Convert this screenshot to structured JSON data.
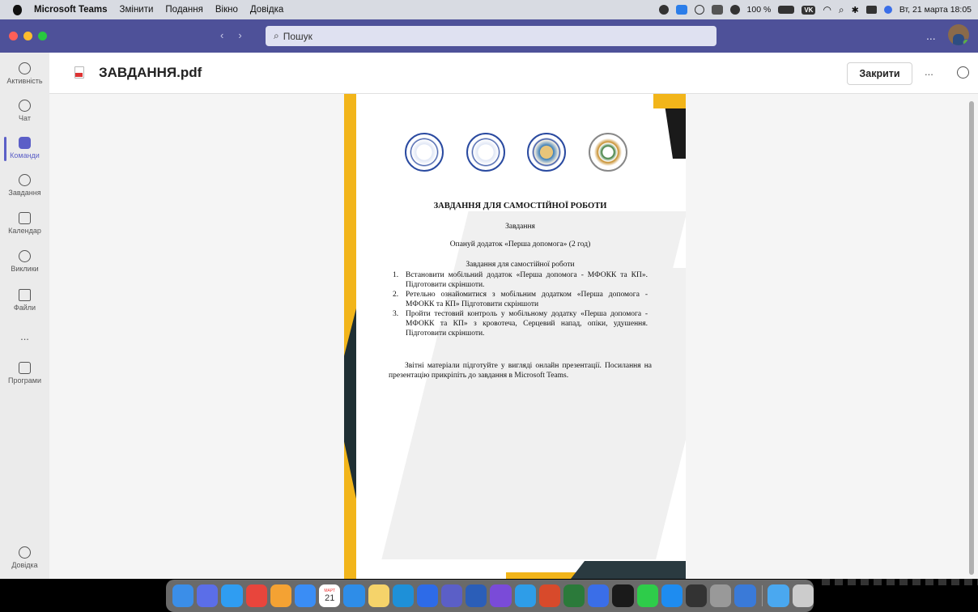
{
  "menubar": {
    "app_name": "Microsoft Teams",
    "items": [
      "Змінити",
      "Подання",
      "Вікно",
      "Довідка"
    ],
    "battery": "100 %",
    "keyboard": "VK",
    "datetime": "Вт, 21 марта 18:05"
  },
  "titlebar": {
    "search_placeholder": "Пошук",
    "more": "...",
    "nav_back": "‹",
    "nav_forward": "›"
  },
  "rail": {
    "items": [
      {
        "label": "Активність",
        "icon": "bell-icon"
      },
      {
        "label": "Чат",
        "icon": "chat-icon"
      },
      {
        "label": "Команди",
        "icon": "teams-icon"
      },
      {
        "label": "Завдання",
        "icon": "assignments-icon"
      },
      {
        "label": "Календар",
        "icon": "calendar-icon"
      },
      {
        "label": "Виклики",
        "icon": "phone-icon"
      },
      {
        "label": "Файли",
        "icon": "file-icon"
      },
      {
        "label": "...",
        "icon": "more-icon"
      },
      {
        "label": "Програми",
        "icon": "apps-icon"
      }
    ],
    "help_label": "Довідка"
  },
  "header": {
    "file_name": "ЗАВДАННЯ.pdf",
    "close_label": "Закрити",
    "more": "..."
  },
  "document": {
    "title": "ЗАВДАННЯ ДЛЯ САМОСТІЙНОЇ РОБОТИ",
    "subtitle": "Завдання",
    "intro": "Опануй додаток «Перша допомога» (2 год)",
    "section_title": "Завдання для самостійної роботи",
    "tasks": [
      "Встановити мобільний додаток «Перша допомога - МФОКК та КП». Підготовити скріншоти.",
      "Ретельно ознайомитися з мобільним додатком «Перша допомога - МФОКК та КП» Підготовити скріншоти",
      "Пройти тестовий контроль у мобільному додатку «Перша допомога - МФОКК та КП» з кровотеча, Серцевий напад, опіки, удушення. Підготовити скріншоти."
    ],
    "footer": "Звітні матеріали підготуйте у вигляді онлайн презентації. Посилання на презентацію прикріпіть до завдання в Microsoft Teams."
  },
  "dock": {
    "calendar_day": "21",
    "calendar_month": "МАРТ"
  },
  "colors": {
    "teams_purple": "#4e5199",
    "accent": "#5b5fc7",
    "doc_yellow": "#f2b51a",
    "doc_dark": "#1f2f33"
  }
}
